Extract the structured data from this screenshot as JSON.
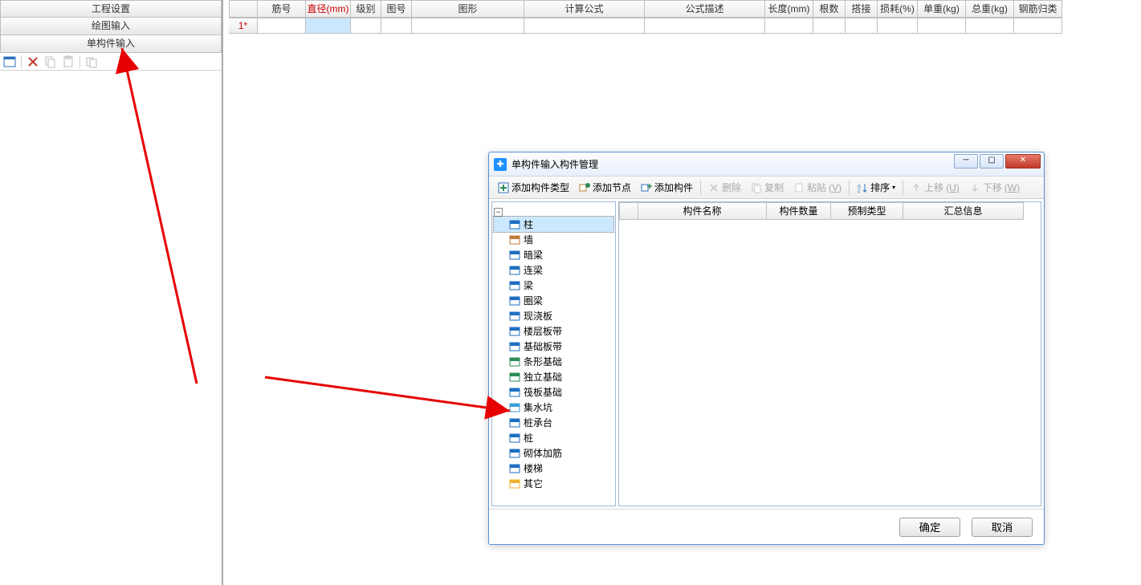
{
  "sidebar": {
    "items": [
      {
        "label": "工程设置"
      },
      {
        "label": "绘图输入"
      },
      {
        "label": "单构件输入"
      }
    ]
  },
  "main_table": {
    "columns": [
      {
        "label": "",
        "w": 36
      },
      {
        "label": "筋号",
        "w": 60
      },
      {
        "label": "直径(mm)",
        "w": 56,
        "highlight": true
      },
      {
        "label": "级别",
        "w": 38
      },
      {
        "label": "图号",
        "w": 38
      },
      {
        "label": "图形",
        "w": 140
      },
      {
        "label": "计算公式",
        "w": 150
      },
      {
        "label": "公式描述",
        "w": 150
      },
      {
        "label": "长度(mm)",
        "w": 60
      },
      {
        "label": "根数",
        "w": 40
      },
      {
        "label": "搭接",
        "w": 40
      },
      {
        "label": "损耗(%)",
        "w": 50
      },
      {
        "label": "单重(kg)",
        "w": 60
      },
      {
        "label": "总重(kg)",
        "w": 60
      },
      {
        "label": "钢筋归类",
        "w": 60
      }
    ],
    "row1_label": "1*"
  },
  "dialog": {
    "title": "单构件输入构件管理",
    "toolbar": {
      "add_type": "添加构件类型",
      "add_node": "添加节点",
      "add_member": "添加构件",
      "delete": "删除",
      "copy": "复制",
      "paste": "粘贴",
      "paste_key": "(V)",
      "sort": "排序",
      "up": "上移",
      "up_key": "(U)",
      "down": "下移",
      "down_key": "(W)"
    },
    "tree": [
      {
        "label": "柱",
        "sel": true,
        "color": "#1e6fc0"
      },
      {
        "label": "墙",
        "color": "#c27b3e"
      },
      {
        "label": "暗梁",
        "color": "#1e6fc0"
      },
      {
        "label": "连梁",
        "color": "#1e6fc0"
      },
      {
        "label": "梁",
        "color": "#1e6fc0"
      },
      {
        "label": "圈梁",
        "color": "#1e6fc0"
      },
      {
        "label": "现浇板",
        "color": "#1e6fc0"
      },
      {
        "label": "楼层板带",
        "color": "#1e6fc0"
      },
      {
        "label": "基础板带",
        "color": "#1e6fc0"
      },
      {
        "label": "条形基础",
        "color": "#2e8b57"
      },
      {
        "label": "独立基础",
        "color": "#2e8b57"
      },
      {
        "label": "筏板基础",
        "color": "#1e6fc0"
      },
      {
        "label": "集水坑",
        "color": "#3aa0d8"
      },
      {
        "label": "桩承台",
        "color": "#1e6fc0"
      },
      {
        "label": "桩",
        "color": "#1e6fc0"
      },
      {
        "label": "砌体加筋",
        "color": "#1e6fc0"
      },
      {
        "label": "楼梯",
        "color": "#1e6fc0"
      },
      {
        "label": "其它",
        "color": "#f0b030"
      }
    ],
    "grid_columns": [
      {
        "label": "",
        "w": 24
      },
      {
        "label": "构件名称",
        "w": 160
      },
      {
        "label": "构件数量",
        "w": 80
      },
      {
        "label": "预制类型",
        "w": 90
      },
      {
        "label": "汇总信息",
        "w": 150
      }
    ],
    "ok": "确定",
    "cancel": "取消"
  }
}
